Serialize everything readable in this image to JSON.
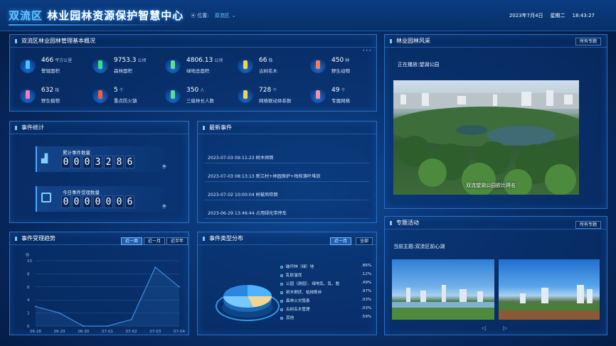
{
  "header": {
    "title_a": "双流区",
    "title_b": "林业园林资源保护智慧中心",
    "loc_label": "位置:",
    "loc_value": "双流区",
    "date": "2023年7月4日",
    "weekday": "星期二",
    "time": "18:43:27"
  },
  "overview": {
    "title": "双流区林业园林管理基本概况",
    "items": [
      {
        "num": "466",
        "unit": "平方公里",
        "label": "警辖面积",
        "icon": "person-icon"
      },
      {
        "num": "9753.3",
        "unit": "公顷",
        "label": "森林面积",
        "icon": "forest-icon"
      },
      {
        "num": "4806.13",
        "unit": "公顷",
        "label": "绿地总面积",
        "icon": "grass-icon"
      },
      {
        "num": "66",
        "unit": "株",
        "label": "古树名木",
        "icon": "tree-icon"
      },
      {
        "num": "450",
        "unit": "种",
        "label": "野生动物",
        "icon": "bird-icon"
      },
      {
        "num": "632",
        "unit": "株",
        "label": "野生植物",
        "icon": "flower-icon"
      },
      {
        "num": "5",
        "unit": "个",
        "label": "重点防火镇",
        "icon": "fire-icon"
      },
      {
        "num": "350",
        "unit": "人",
        "label": "三级林长人数",
        "icon": "ranger-icon"
      },
      {
        "num": "728",
        "unit": "个",
        "label": "网格联动体系数",
        "icon": "grid-icon"
      },
      {
        "num": "49",
        "unit": "个",
        "label": "专属网格",
        "icon": "crown-icon"
      }
    ]
  },
  "scenery": {
    "title": "林业园林风采",
    "btn": "所有专题",
    "playing": "正在播放:望湖公园",
    "caption": "双流望湖公园欲比得名"
  },
  "events_stat": {
    "title": "事件统计",
    "total_label": "累计事件数量",
    "total": [
      "0",
      "0",
      "0",
      "3",
      "2",
      "8",
      "6"
    ],
    "today_label": "今日事件受理数量",
    "today": [
      "0",
      "0",
      "0",
      "0",
      "0",
      "0",
      "6"
    ],
    "unit": "件"
  },
  "latest": {
    "title": "最新事件",
    "items": [
      "2023-07-03 09:11:23 树木倾倒",
      "2023-07-03 08:13:13 新江村+林园保护+枯枝落叶堆放",
      "2023-07-02 10:00:04 树被风吹倒",
      "2023-06-29 13:46:44 占用绿化带停车"
    ]
  },
  "trend": {
    "title": "事件受理趋势",
    "tabs": [
      "近一周",
      "近一月",
      "近半年"
    ],
    "ylabel": "件"
  },
  "types": {
    "title": "事件类型分布",
    "tabs": [
      "近一月",
      "全部"
    ],
    "legend": [
      {
        "name": "破坏林（绿）地",
        "pct": ".86%"
      },
      {
        "name": "乱砍滥伐",
        "pct": ".12%"
      },
      {
        "name": "公园（游园）、绿地乱、乱、脏",
        "pct": ".49%"
      },
      {
        "name": "树木倒伏、枯枝断丝",
        "pct": ".97%"
      },
      {
        "name": "森林火灾隐患",
        "pct": ".03%"
      },
      {
        "name": "古树名木管理",
        "pct": ".03%"
      },
      {
        "name": "其他",
        "pct": ".59%"
      }
    ]
  },
  "topic": {
    "title": "专题活动",
    "btn": "所有专题",
    "subject": "当前主题:双流区前心湖"
  },
  "chart_data": {
    "type": "line",
    "categories": [
      "06-28",
      "06-29",
      "06-30",
      "07-01",
      "07-02",
      "07-03",
      "07-04"
    ],
    "series": [
      {
        "values": [
          3,
          2,
          0,
          0,
          1,
          9,
          6
        ]
      }
    ],
    "ylim": [
      0,
      10
    ],
    "yticks": [
      0,
      2,
      4,
      6,
      8,
      10
    ],
    "ylabel": "件",
    "color": "#3a8fe0"
  }
}
